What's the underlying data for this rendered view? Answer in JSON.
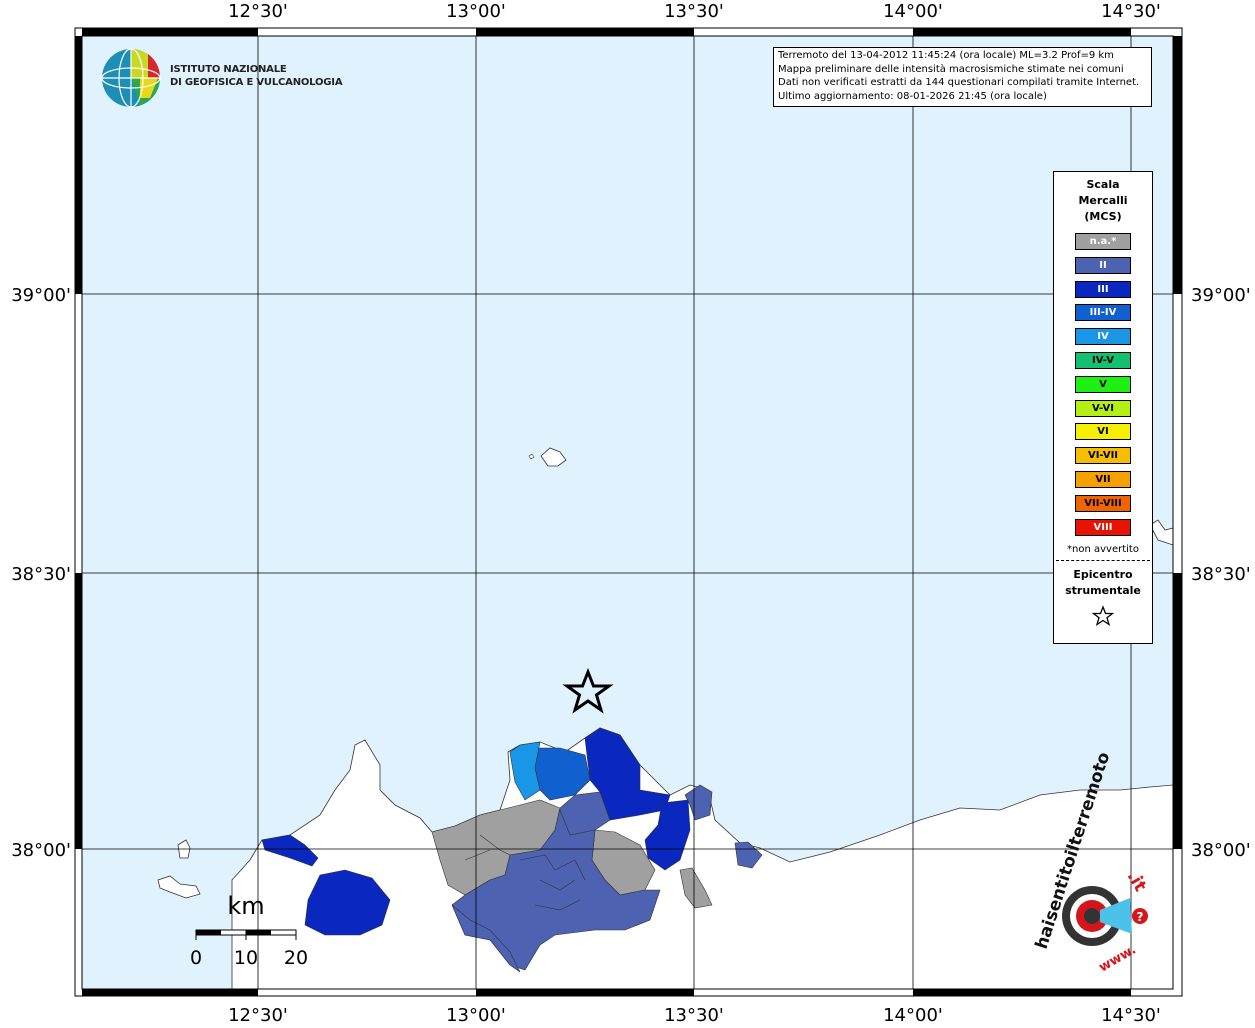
{
  "header": {
    "logo_line1": "ISTITUTO NAZIONALE",
    "logo_line2": "DI GEOFISICA E VULCANOLOGIA"
  },
  "info": {
    "line1": "Terremoto del 13-04-2012 11:45:24 (ora locale) ML=3.2 Prof=9 km",
    "line2": "Mappa preliminare delle intensità macrosismiche stimate nei comuni",
    "line3": "Dati non verificati estratti da 144 questionari compilati tramite Internet.",
    "line4": "Ultimo aggiornamento: 08-01-2026 21:45 (ora locale)"
  },
  "axes": {
    "lon_labels": [
      "12°30'",
      "13°00'",
      "13°30'",
      "14°00'",
      "14°30'"
    ],
    "lat_labels": [
      "39°00'",
      "38°30'",
      "38°00'"
    ]
  },
  "scale_bar": {
    "unit": "km",
    "ticks": [
      "0",
      "10",
      "20"
    ]
  },
  "legend": {
    "title_line1": "Scala",
    "title_line2": "Mercalli",
    "title_line3": "(MCS)",
    "items": [
      {
        "label": "n.a.*",
        "color": "#a0a0a0",
        "dark": false
      },
      {
        "label": "II",
        "color": "#4d62b0",
        "dark": false
      },
      {
        "label": "III",
        "color": "#0a28c0",
        "dark": false
      },
      {
        "label": "III-IV",
        "color": "#1060d0",
        "dark": false
      },
      {
        "label": "IV",
        "color": "#1a96e6",
        "dark": false
      },
      {
        "label": "IV-V",
        "color": "#12c070",
        "dark": true
      },
      {
        "label": "V",
        "color": "#1ef014",
        "dark": true
      },
      {
        "label": "V-VI",
        "color": "#b4f014",
        "dark": true
      },
      {
        "label": "VI",
        "color": "#f6f000",
        "dark": true
      },
      {
        "label": "VI-VII",
        "color": "#f6be00",
        "dark": true
      },
      {
        "label": "VII",
        "color": "#f6a000",
        "dark": true
      },
      {
        "label": "VII-VIII",
        "color": "#f06400",
        "dark": true
      },
      {
        "label": "VIII",
        "color": "#e61400",
        "dark": false
      }
    ],
    "note": "*non avvertito",
    "epicenter_line1": "Epicentro",
    "epicenter_line2": "strumentale",
    "star_symbol": "☆"
  },
  "brand": {
    "text1": "haisentitoilterremoto",
    "text2": ".it",
    "text3": "www."
  },
  "colors": {
    "sea": "#e0f2fd",
    "land": "#ffffff",
    "grid": "#000000"
  }
}
